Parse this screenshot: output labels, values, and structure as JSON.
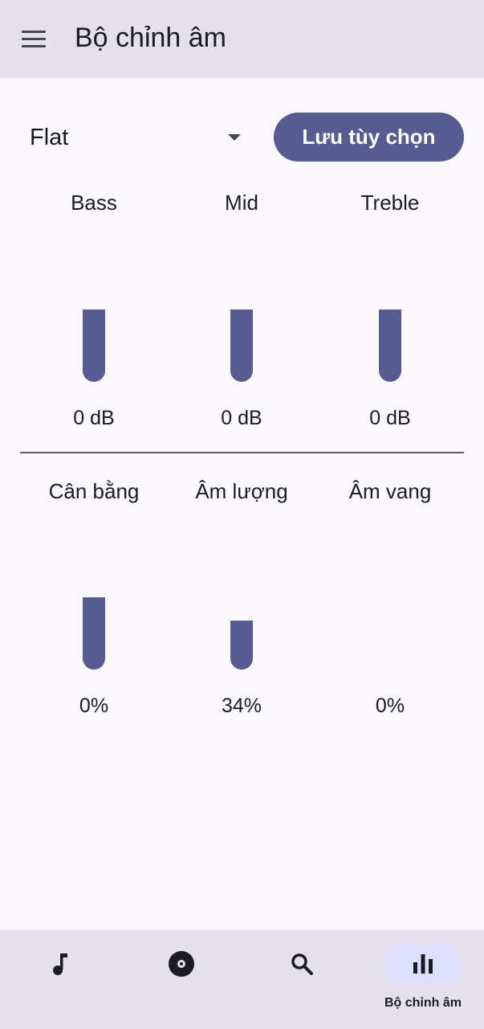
{
  "app": {
    "title": "Bộ chỉnh âm"
  },
  "colors": {
    "accent": "#565b92",
    "topbar_bg": "#e4e1ec",
    "page_bg": "#fbf8fd",
    "nav_active_pill": "#dfe0ff"
  },
  "preset": {
    "selected": "Flat",
    "save_label": "Lưu tùy chọn"
  },
  "tone_bands": [
    {
      "label": "Bass",
      "value": "0 dB",
      "level": 0.53
    },
    {
      "label": "Mid",
      "value": "0 dB",
      "level": 0.53
    },
    {
      "label": "Treble",
      "value": "0 dB",
      "level": 0.53
    }
  ],
  "effects": [
    {
      "label": "Cân bằng",
      "value": "0%",
      "level": 0.53
    },
    {
      "label": "Âm lượng",
      "value": "34%",
      "level": 0.36
    },
    {
      "label": "Âm vang",
      "value": "0%",
      "level": 0
    }
  ],
  "bottom_nav": {
    "items": [
      {
        "icon": "music-note-icon",
        "label": ""
      },
      {
        "icon": "disc-icon",
        "label": ""
      },
      {
        "icon": "search-icon",
        "label": ""
      },
      {
        "icon": "equalizer-icon",
        "label": "Bộ chỉnh âm",
        "active": true
      }
    ]
  }
}
